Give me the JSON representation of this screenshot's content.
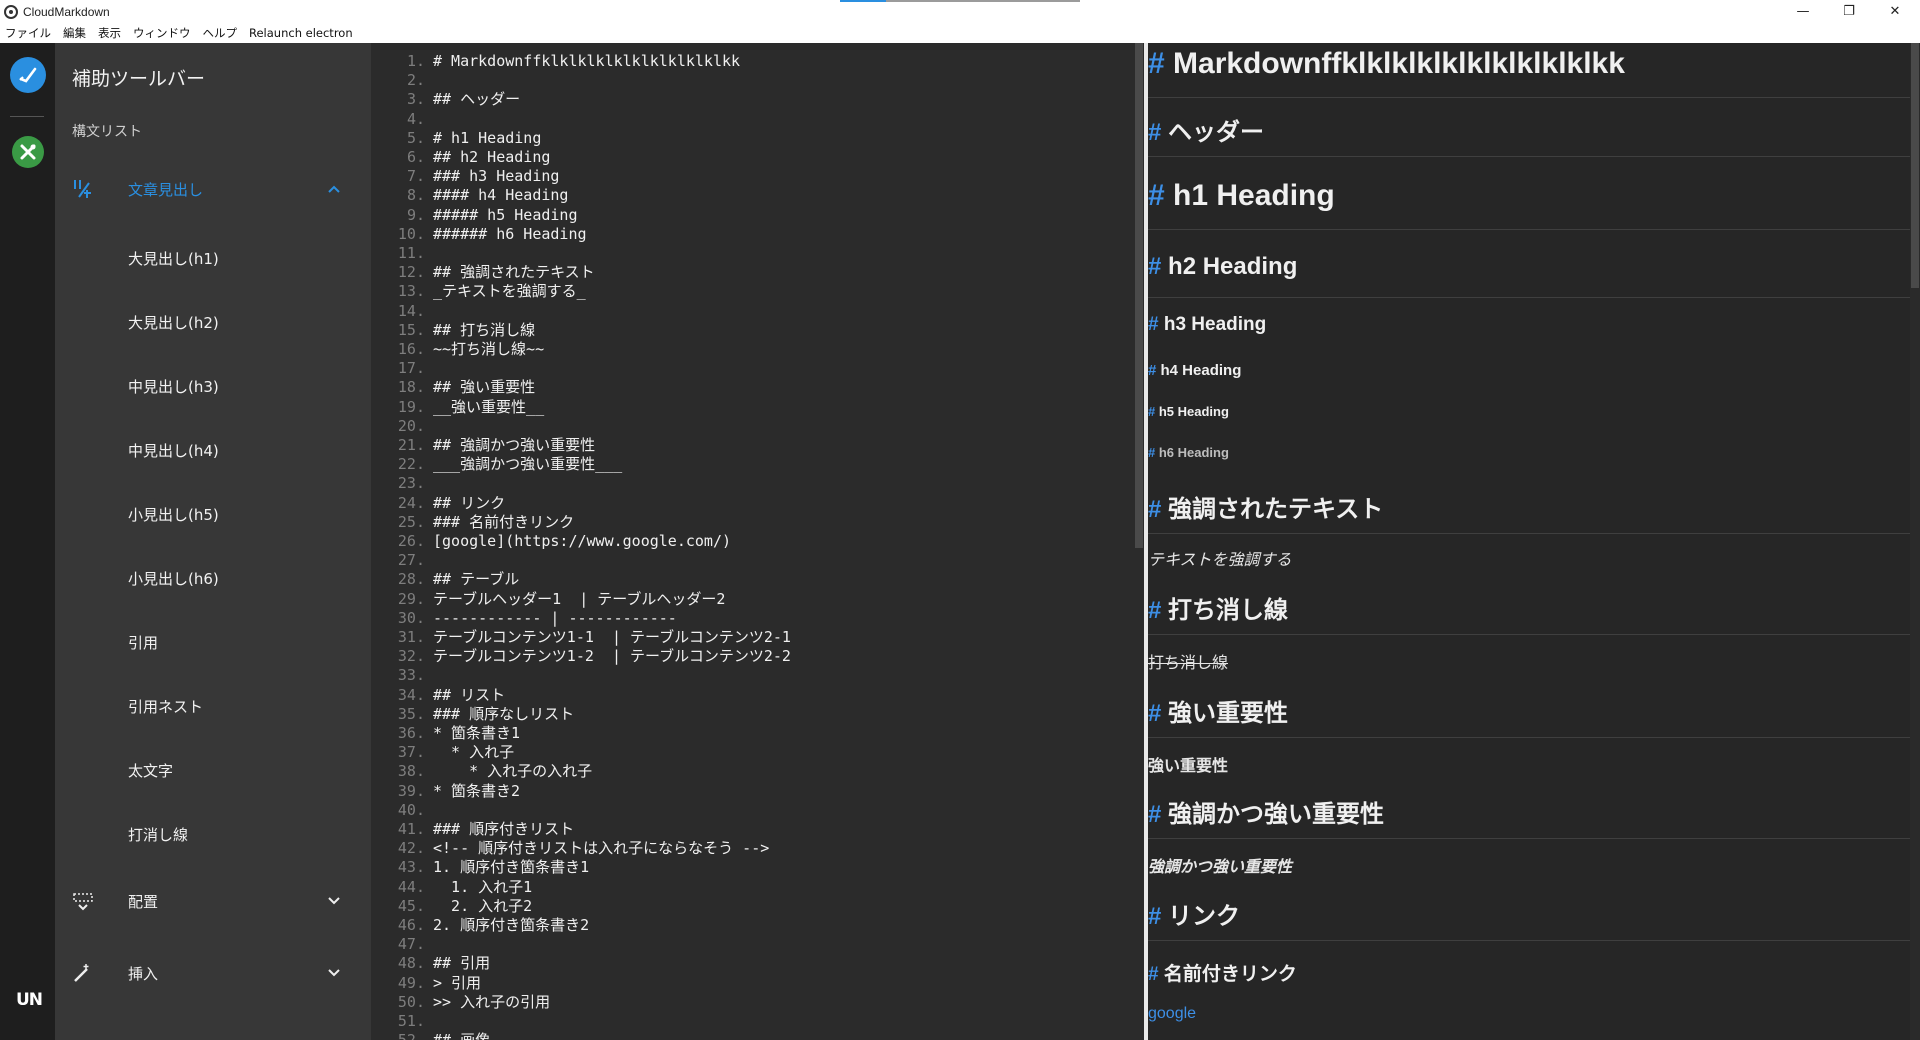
{
  "window": {
    "title": "CloudMarkdown",
    "minimize": "—",
    "restore": "❐",
    "close": "✕"
  },
  "menu": [
    "ファイル",
    "編集",
    "表示",
    "ウィンドウ",
    "ヘルプ",
    "Relaunch electron"
  ],
  "activity": {
    "primary_icon": "edit-check-icon",
    "secondary_icon": "tools-icon",
    "logo": "UN",
    "primary_color": "#2a8fe0",
    "secondary_color": "#3a9a45"
  },
  "toolpanel": {
    "title": "補助ツールバー",
    "subtitle": "構文リスト",
    "heading_section": "文章見出し",
    "items": [
      "大見出し(h1)",
      "大見出し(h2)",
      "中見出し(h3)",
      "中見出し(h4)",
      "小見出し(h5)",
      "小見出し(h6)",
      "引用",
      "引用ネスト",
      "太文字",
      "打消し線"
    ],
    "layout_section": "配置",
    "insert_section": "挿入",
    "accent_color": "#2a8fe0"
  },
  "editor": {
    "lines": [
      "# Markdownffklklklklklklklklklklkk",
      "",
      "## ヘッダー",
      "",
      "# h1 Heading",
      "## h2 Heading",
      "### h3 Heading",
      "#### h4 Heading",
      "##### h5 Heading",
      "###### h6 Heading",
      "",
      "## 強調されたテキスト",
      "_テキストを強調する_",
      "",
      "## 打ち消し線",
      "~~打ち消し線~~",
      "",
      "## 強い重要性",
      "__強い重要性__",
      "",
      "## 強調かつ強い重要性",
      "___強調かつ強い重要性___",
      "",
      "## リンク",
      "### 名前付きリンク",
      "[google](https://www.google.com/)",
      "",
      "## テーブル",
      "テーブルヘッダー1  | テーブルヘッダー2",
      "------------ | ------------",
      "テーブルコンテンツ1-1  | テーブルコンテンツ2-1",
      "テーブルコンテンツ1-2  | テーブルコンテンツ2-2",
      "",
      "## リスト",
      "### 順序なしリスト",
      "* 箇条書き1",
      "  * 入れ子",
      "    * 入れ子の入れ子",
      "* 箇条書き2",
      "",
      "### 順序付きリスト",
      "<!-- 順序付きリストは入れ子にならなそう -->",
      "1. 順序付き箇条書き1",
      "  1. 入れ子1",
      "  2. 入れ子2",
      "2. 順序付き箇条書き2",
      "",
      "## 引用",
      "> 引用",
      ">> 入れ子の引用",
      "",
      "## 画像"
    ]
  },
  "preview": {
    "hash": "#",
    "headings": [
      {
        "level": 1,
        "text": "Markdownffklklklklklklklklklklkk"
      },
      {
        "level": 2,
        "text": "ヘッダー"
      },
      {
        "level": 1,
        "text": "h1 Heading"
      },
      {
        "level": 2,
        "text": "h2 Heading"
      },
      {
        "level": 3,
        "text": "h3 Heading"
      },
      {
        "level": 4,
        "text": "h4 Heading"
      },
      {
        "level": 5,
        "text": "h5 Heading"
      },
      {
        "level": 6,
        "text": "h6 Heading"
      },
      {
        "level": 2,
        "text": "強調されたテキスト"
      },
      {
        "level": 2,
        "text": "打ち消し線"
      },
      {
        "level": 2,
        "text": "強い重要性"
      },
      {
        "level": 2,
        "text": "強調かつ強い重要性"
      },
      {
        "level": 2,
        "text": "リンク"
      },
      {
        "level": 3,
        "text": "名前付きリンク"
      }
    ],
    "emphasis": "テキストを強調する",
    "strike": "打ち消し線",
    "strong": "強い重要性",
    "strong_em": "強調かつ強い重要性",
    "link": "google",
    "link_color": "#3d8fe6"
  }
}
